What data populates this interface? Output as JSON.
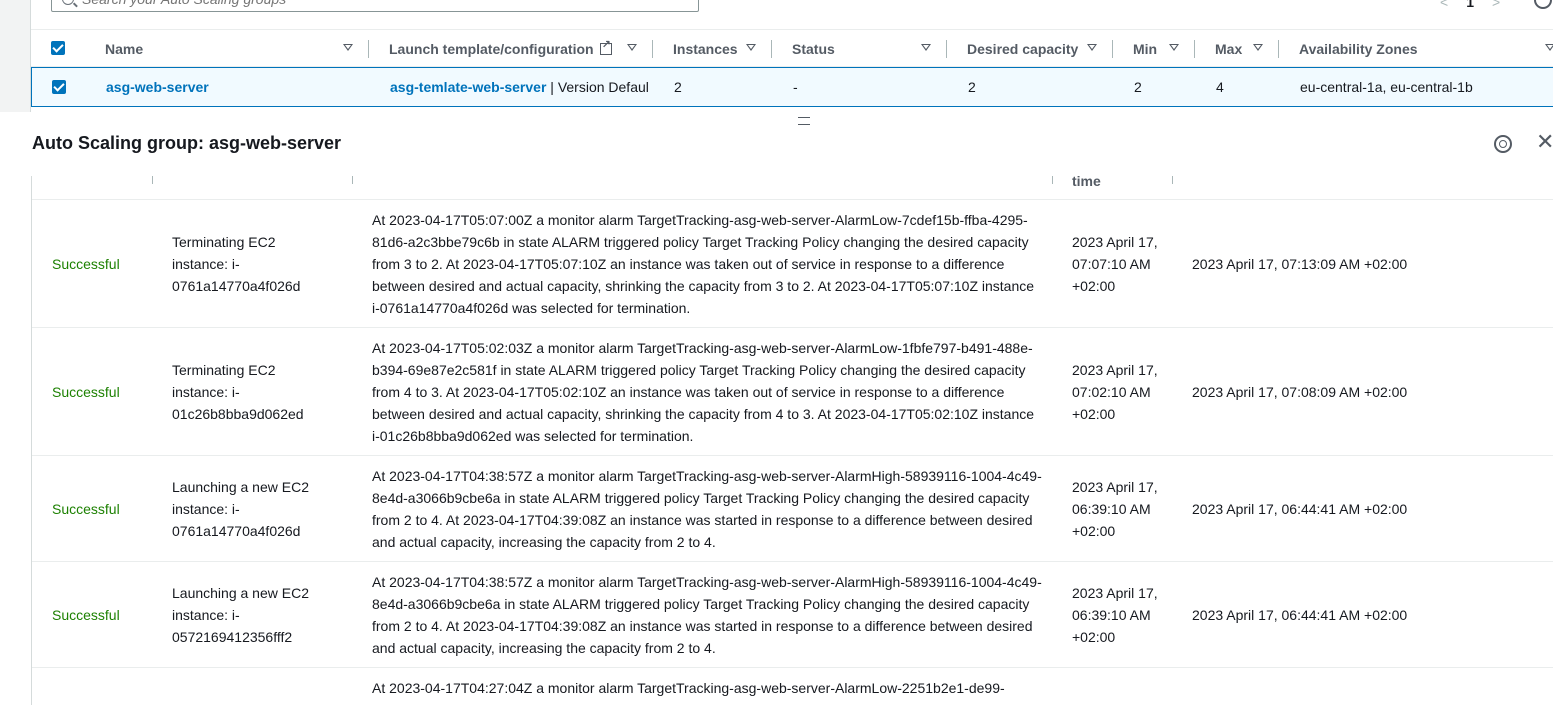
{
  "search": {
    "placeholder": "Search your Auto Scaling groups"
  },
  "pager": {
    "prev": "<",
    "page": "1",
    "next": ">"
  },
  "asg_table": {
    "columns": [
      "Name",
      "Launch template/configuration",
      "Instances",
      "Status",
      "Desired capacity",
      "Min",
      "Max",
      "Availability Zones"
    ],
    "row": {
      "name": "asg-web-server",
      "launch_template": "asg-temlate-web-server",
      "launch_version": " | Version Defaul",
      "instances": "2",
      "status": "-",
      "desired": "2",
      "min": "2",
      "max": "4",
      "zones": "eu-central-1a, eu-central-1b"
    }
  },
  "panel": {
    "title": "Auto Scaling group: asg-web-server",
    "time_header": "time"
  },
  "activities": [
    {
      "status": "Successful",
      "description": "Terminating EC2 instance: i-0761a14770a4f026d",
      "cause": "At 2023-04-17T05:07:00Z a monitor alarm TargetTracking-asg-web-server-AlarmLow-7cdef15b-ffba-4295-81d6-a2c3bbe79c6b in state ALARM triggered policy Target Tracking Policy changing the desired capacity from 3 to 2. At 2023-04-17T05:07:10Z an instance was taken out of service in response to a difference between desired and actual capacity, shrinking the capacity from 3 to 2. At 2023-04-17T05:07:10Z instance i-0761a14770a4f026d was selected for termination.",
      "start": "2023 April 17, 07:07:10 AM +02:00",
      "end": "2023 April 17, 07:13:09 AM +02:00"
    },
    {
      "status": "Successful",
      "description": "Terminating EC2 instance: i-01c26b8bba9d062ed",
      "cause": "At 2023-04-17T05:02:03Z a monitor alarm TargetTracking-asg-web-server-AlarmLow-1fbfe797-b491-488e-b394-69e87e2c581f in state ALARM triggered policy Target Tracking Policy changing the desired capacity from 4 to 3. At 2023-04-17T05:02:10Z an instance was taken out of service in response to a difference between desired and actual capacity, shrinking the capacity from 4 to 3. At 2023-04-17T05:02:10Z instance i-01c26b8bba9d062ed was selected for termination.",
      "start": "2023 April 17, 07:02:10 AM +02:00",
      "end": "2023 April 17, 07:08:09 AM +02:00"
    },
    {
      "status": "Successful",
      "description": "Launching a new EC2 instance: i-0761a14770a4f026d",
      "cause": "At 2023-04-17T04:38:57Z a monitor alarm TargetTracking-asg-web-server-AlarmHigh-58939116-1004-4c49-8e4d-a3066b9cbe6a in state ALARM triggered policy Target Tracking Policy changing the desired capacity from 2 to 4. At 2023-04-17T04:39:08Z an instance was started in response to a difference between desired and actual capacity, increasing the capacity from 2 to 4.",
      "start": "2023 April 17, 06:39:10 AM +02:00",
      "end": "2023 April 17, 06:44:41 AM +02:00"
    },
    {
      "status": "Successful",
      "description": "Launching a new EC2 instance: i-0572169412356fff2",
      "cause": "At 2023-04-17T04:38:57Z a monitor alarm TargetTracking-asg-web-server-AlarmHigh-58939116-1004-4c49-8e4d-a3066b9cbe6a in state ALARM triggered policy Target Tracking Policy changing the desired capacity from 2 to 4. At 2023-04-17T04:39:08Z an instance was started in response to a difference between desired and actual capacity, increasing the capacity from 2 to 4.",
      "start": "2023 April 17, 06:39:10 AM +02:00",
      "end": "2023 April 17, 06:44:41 AM +02:00"
    },
    {
      "status": "",
      "description": "",
      "cause": "At 2023-04-17T04:27:04Z a monitor alarm TargetTracking-asg-web-server-AlarmLow-2251b2e1-de99-",
      "start": "",
      "end": ""
    }
  ]
}
